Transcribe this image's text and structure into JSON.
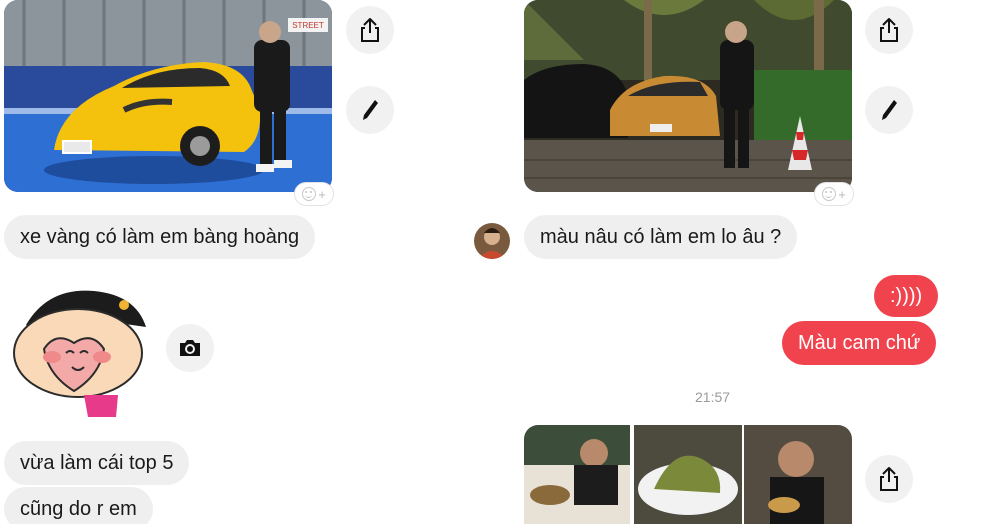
{
  "left_thread": {
    "photo": {
      "alt": "yellow sports car photo",
      "sign_text": "STREET"
    },
    "messages": [
      {
        "text": "xe vàng có làm em bàng hoàng"
      },
      {
        "text": "vừa làm cái top 5"
      },
      {
        "text": "cũng do r em"
      }
    ],
    "icons": {
      "share": "share-icon",
      "edit": "pencil-icon",
      "camera": "camera-icon",
      "react": "add-reaction-icon"
    }
  },
  "right_thread": {
    "messages_in": [
      {
        "text": "màu nâu có làm em lo âu ?"
      }
    ],
    "messages_out": [
      {
        "text": ":))))"
      },
      {
        "text": "Màu cam chứ"
      }
    ],
    "timestamp": "21:57",
    "icons": {
      "share": "share-icon",
      "edit": "pencil-icon",
      "react": "add-reaction-icon"
    }
  },
  "colors": {
    "outgoing_bubble": "#f0434e",
    "incoming_bubble": "#efefef",
    "timestamp": "#9a9a9a"
  }
}
